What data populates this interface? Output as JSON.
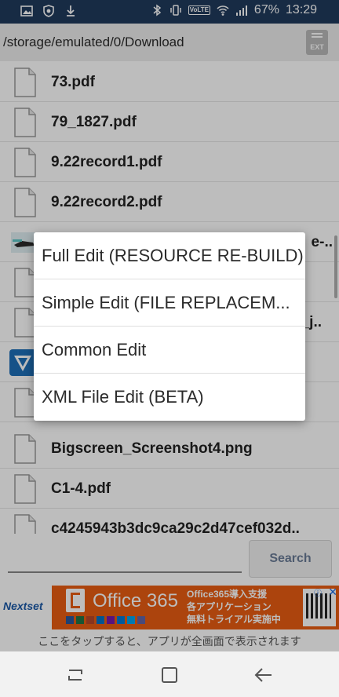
{
  "status_bar": {
    "battery": "67%",
    "time": "13:29",
    "volte": "VoLTE",
    "left_icons": [
      "image-icon",
      "shield-icon",
      "download-icon"
    ],
    "right_icons": [
      "bluetooth-icon",
      "vibrate-icon",
      "wifi-icon",
      "signal-icon"
    ]
  },
  "path_bar": {
    "path": "/storage/emulated/0/Download",
    "ext_button": "EXT"
  },
  "files": [
    {
      "name": "73.pdf",
      "icon": "file-icon"
    },
    {
      "name": "79_1827.pdf",
      "icon": "file-icon"
    },
    {
      "name": "9.22record1.pdf",
      "icon": "file-icon"
    },
    {
      "name": "9.22record2.pdf",
      "icon": "file-icon"
    },
    {
      "name": "e-..",
      "icon": "image-thumbnail"
    },
    {
      "name": "",
      "icon": "file-icon"
    },
    {
      "name": "_j..",
      "icon": "file-icon"
    },
    {
      "name": "",
      "icon": "app-icon"
    },
    {
      "name": "",
      "icon": "file-icon"
    },
    {
      "name": "Bigscreen_Screenshot4.png",
      "icon": "file-icon"
    },
    {
      "name": "C1-4.pdf",
      "icon": "file-icon"
    },
    {
      "name": "c4245943b3dc9ca29c2d47cef032d..",
      "icon": "file-icon"
    }
  ],
  "popup_menu": {
    "items": [
      "Full Edit (RESOURCE RE-BUILD)",
      "Simple Edit (FILE REPLACEM...",
      "Common Edit",
      "XML File Edit (BETA)"
    ]
  },
  "search": {
    "button_label": "Search",
    "value": ""
  },
  "ad": {
    "brand": "Nextset",
    "product": "Office 365",
    "lines": [
      "Office365導入支援",
      "各アプリケーション",
      "無料トライアル実施中"
    ],
    "note": "ここをタップすると、アプリが全画面で表示されます",
    "accent": "#e85c12"
  },
  "nav_bar": {
    "buttons": [
      "recent-apps-icon",
      "home-icon",
      "back-icon"
    ]
  },
  "colors": {
    "status_bar": "#1f3a5c",
    "path_bar": "#ececec",
    "search_text": "#6a7b96"
  }
}
